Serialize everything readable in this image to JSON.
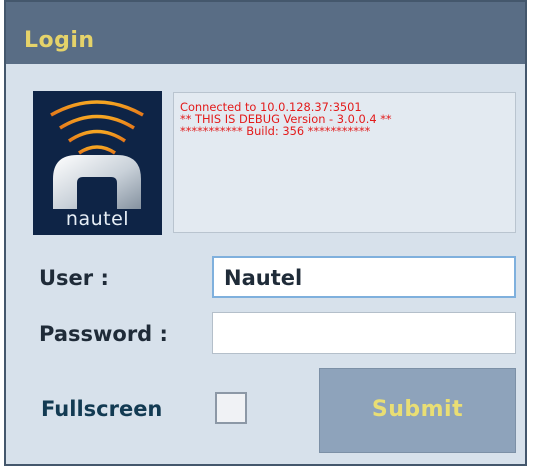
{
  "window": {
    "title": "Login"
  },
  "logo": {
    "brand": "nautel"
  },
  "status": {
    "lines": [
      "Connected to 10.0.128.37:3501",
      "** THIS IS DEBUG Version - 3.0.0.4 **",
      "*********** Build: 356 ***********"
    ]
  },
  "form": {
    "user_label": "User :",
    "user_value": "Nautel",
    "password_label": "Password :",
    "password_value": "",
    "fullscreen_label": "Fullscreen",
    "fullscreen_checked": false,
    "submit_label": "Submit"
  },
  "colors": {
    "titlebar": "#596d85",
    "title_text": "#e5d36a",
    "panel": "#d7e1eb",
    "status_text": "#e31b1b",
    "submit_bg": "#8ea3bb",
    "submit_text": "#e9de74"
  }
}
